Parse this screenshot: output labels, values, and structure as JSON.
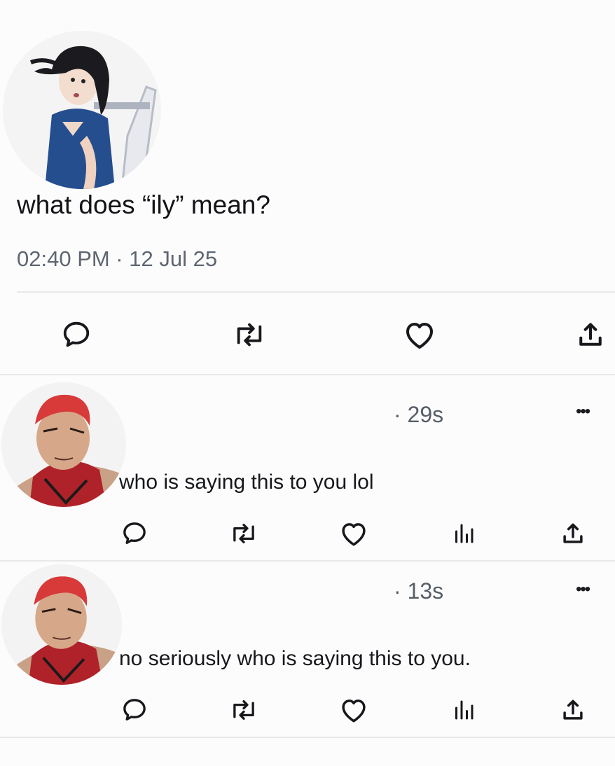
{
  "post": {
    "text": "what does “ily” mean?",
    "timestamp": "02:40 PM · 12 Jul 25",
    "author_avatar": "girl-avatar",
    "actions": [
      {
        "name": "reply-icon"
      },
      {
        "name": "repost-icon"
      },
      {
        "name": "like-icon"
      },
      {
        "name": "share-icon"
      }
    ]
  },
  "replies": [
    {
      "age": "· 29s",
      "text": "who is saying this to you lol",
      "more_label": "•••",
      "avatar": "red-hair-player-avatar",
      "actions": [
        "reply-icon",
        "repost-icon",
        "like-icon",
        "views-icon",
        "share-icon"
      ]
    },
    {
      "age": "· 13s",
      "text": "no seriously who is saying this to you.",
      "more_label": "•••",
      "avatar": "red-hair-player-avatar",
      "actions": [
        "reply-icon",
        "repost-icon",
        "like-icon",
        "views-icon",
        "share-icon"
      ]
    }
  ],
  "colors": {
    "background": "#fdfcfd",
    "text": "#16181c",
    "muted": "#5e6670",
    "divider": "#e8e8ea",
    "jersey_red": "#b0222a",
    "hair_red": "#d83a3a",
    "shirt_blue": "#254e8f"
  }
}
